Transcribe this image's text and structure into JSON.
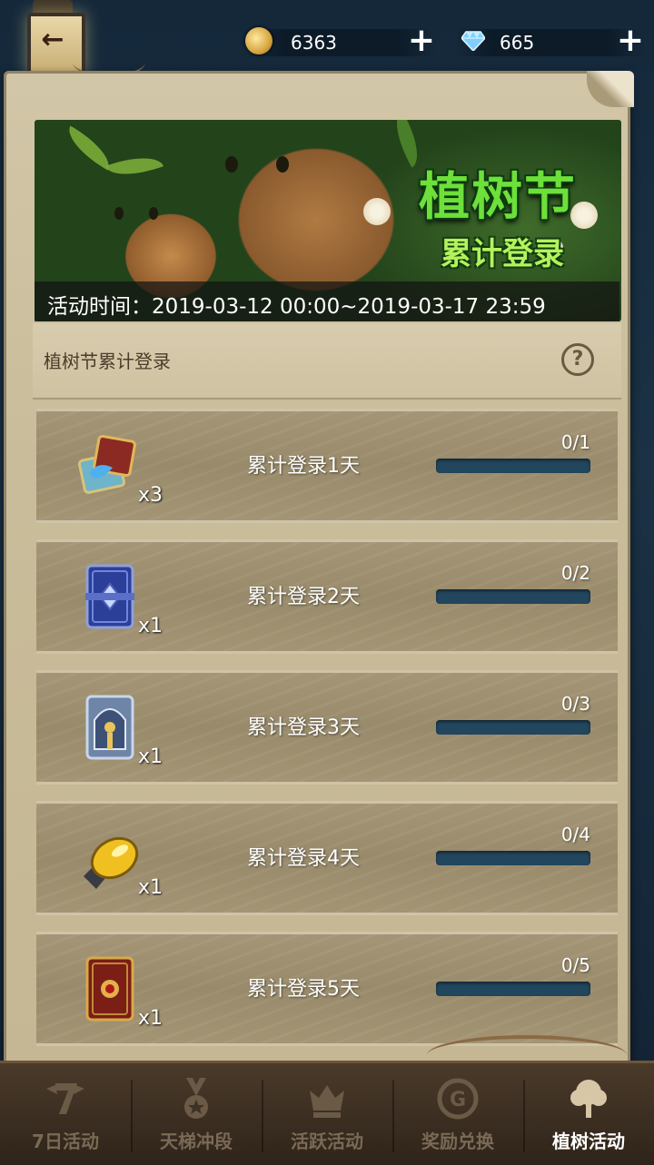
{
  "top_bar": {
    "back_icon": "back-arrow-icon",
    "gold": {
      "icon": "coin-icon",
      "value": "6363",
      "add_label": "+"
    },
    "diamonds": {
      "icon": "diamond-icon",
      "value": "665",
      "add_label": "+"
    }
  },
  "banner": {
    "title": "植树节",
    "subtitle": "累计登录",
    "time_text": "活动时间：2019-03-12 00:00~2019-03-17 23:59"
  },
  "section": {
    "title": "植树节累计登录",
    "help_label": "?"
  },
  "rewards": [
    {
      "item_icon": "card-pack-icon",
      "quantity": "x3",
      "label": "累计登录1天",
      "progress_text": "0/1",
      "progress": 0
    },
    {
      "item_icon": "blue-card-back-icon",
      "quantity": "x1",
      "label": "累计登录2天",
      "progress_text": "0/2",
      "progress": 0
    },
    {
      "item_icon": "silver-card-back-icon",
      "quantity": "x1",
      "label": "累计登录3天",
      "progress_text": "0/3",
      "progress": 0
    },
    {
      "item_icon": "amber-gem-icon",
      "quantity": "x1",
      "label": "累计登录4天",
      "progress_text": "0/4",
      "progress": 0
    },
    {
      "item_icon": "red-card-back-icon",
      "quantity": "x1",
      "label": "累计登录5天",
      "progress_text": "0/5",
      "progress": 0
    }
  ],
  "tabs": [
    {
      "label": "7日活动",
      "icon": "seven-day-icon",
      "active": false
    },
    {
      "label": "天梯冲段",
      "icon": "medal-icon",
      "active": false
    },
    {
      "label": "活跃活动",
      "icon": "crown-icon",
      "active": false
    },
    {
      "label": "奖励兑换",
      "icon": "exchange-icon",
      "active": false
    },
    {
      "label": "植树活动",
      "icon": "tree-icon",
      "active": true
    }
  ],
  "colors": {
    "progress_track": "#23465f",
    "banner_title": "#6de03a",
    "active_tab_text": "#ffffff",
    "inactive_tab_text": "#7a6a55"
  }
}
